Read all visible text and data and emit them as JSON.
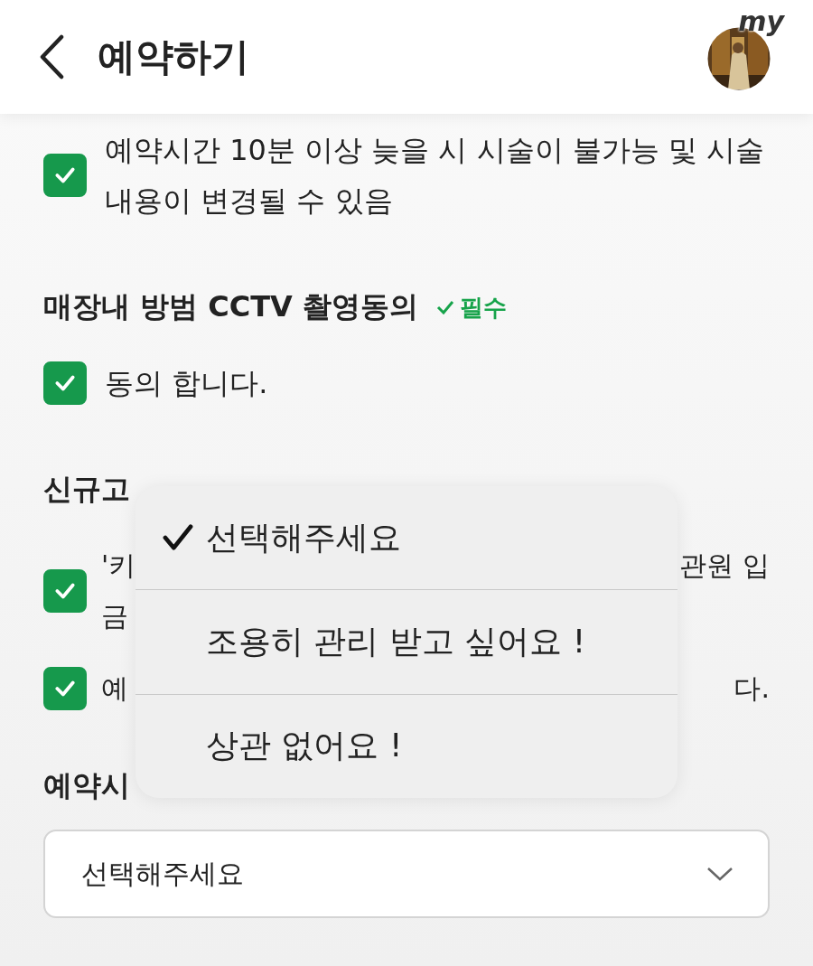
{
  "header": {
    "title": "예약하기",
    "avatar_badge": "my"
  },
  "sections": [
    {
      "kind": "agreement",
      "items": [
        {
          "checked": true,
          "text": "예약시간 10분 이상 늦을 시 시술이 불가능 및 시술 내용이 변경될 수 있음"
        }
      ]
    },
    {
      "kind": "agreement",
      "title": "매장내 방범 CCTV 촬영동의",
      "required": "필수",
      "items": [
        {
          "checked": true,
          "text": "동의 합니다."
        }
      ]
    },
    {
      "kind": "covered",
      "title": "신규고",
      "items": [
        {
          "checked": true,
          "lines": [
            {
              "left": "'키",
              "right": "관원 입"
            },
            {
              "left": "금"
            }
          ]
        },
        {
          "checked": true,
          "lines": [
            {
              "left": "예",
              "right": "다."
            }
          ]
        }
      ]
    },
    {
      "kind": "select",
      "title": "예약시",
      "value": "선택해주세요"
    }
  ],
  "dropdown": {
    "options": [
      {
        "label": "선택해주세요",
        "selected": true
      },
      {
        "label": "조용히 관리 받고 싶어요 !",
        "selected": false
      },
      {
        "label": "상관 없어요 !",
        "selected": false
      }
    ]
  }
}
